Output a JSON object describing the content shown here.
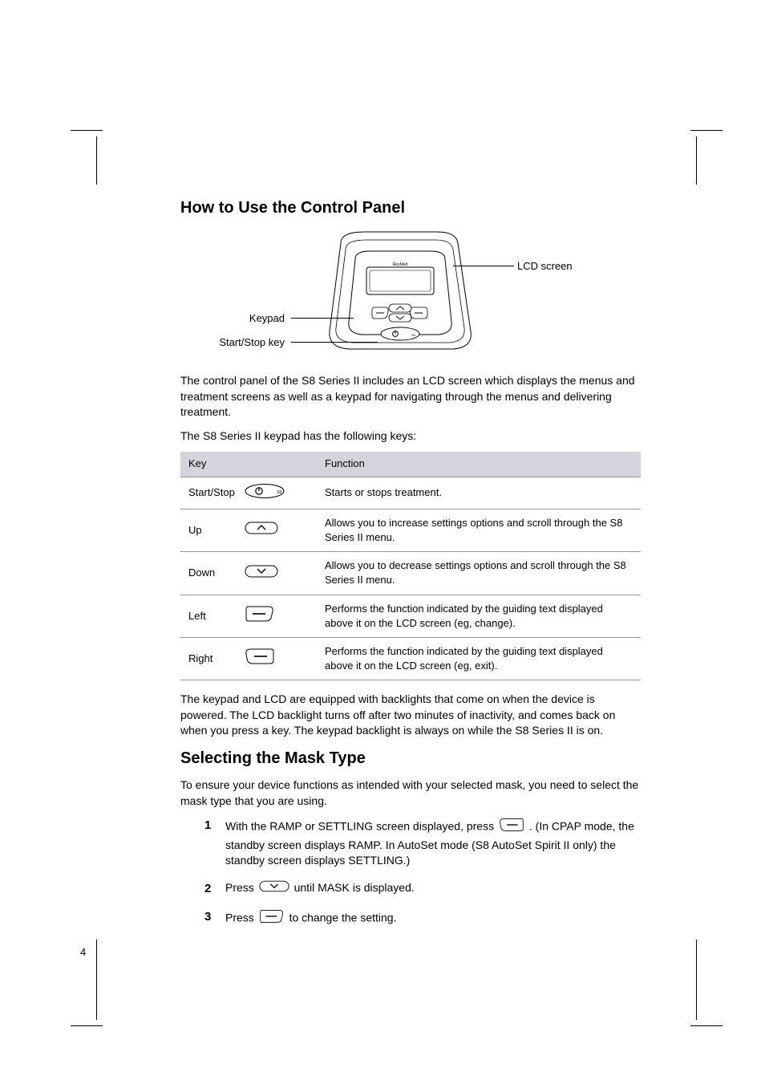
{
  "section1": {
    "title": "How to Use the Control Panel",
    "diagram_labels": {
      "keypad": "Keypad",
      "start_stop_key": "Start/Stop key",
      "lcd_screen": "LCD screen"
    },
    "intro1": "The control panel of the S8 Series II includes an LCD screen which displays the menus and treatment screens as well as a keypad for navigating through the menus and delivering treatment.",
    "intro2": "The S8 Series II keypad has the following keys:",
    "table": {
      "header_key": "Key",
      "header_func": "Function",
      "rows": [
        {
          "name": "Start/Stop",
          "icon": "power",
          "func": "Starts or stops treatment."
        },
        {
          "name": "Up",
          "icon": "up",
          "func": "Allows you to increase settings options and scroll through the S8 Series II menu."
        },
        {
          "name": "Down",
          "icon": "down",
          "func": "Allows you to decrease settings options and scroll through the S8 Series II menu."
        },
        {
          "name": "Left",
          "icon": "left",
          "func": "Performs the function indicated by the guiding text displayed above it on the LCD screen (eg, change)."
        },
        {
          "name": "Right",
          "icon": "right",
          "func": "Performs the function indicated by the guiding text displayed above it on the LCD screen (eg, exit)."
        }
      ]
    },
    "outro": "The keypad and LCD are equipped with backlights that come on when the device is powered. The LCD backlight turns off after two minutes of inactivity, and comes back on when you press a key. The keypad backlight is always on while the S8 Series II is on."
  },
  "section2": {
    "title": "Selecting the Mask Type",
    "intro": "To ensure your device functions as intended with your selected mask, you need to select the mask type that you are using.",
    "steps": [
      {
        "num": "1",
        "pre": "With the RAMP or SETTLING screen displayed, press ",
        "icon": "right",
        "post": " . (In CPAP mode, the standby screen displays RAMP. In AutoSet mode (S8 AutoSet Spirit II only) the standby screen displays SETTLING.)"
      },
      {
        "num": "2",
        "pre": "Press ",
        "icon": "down",
        "post": " until MASK is displayed."
      },
      {
        "num": "3",
        "pre": "Press ",
        "icon": "left",
        "post": " to change the setting."
      }
    ]
  },
  "page_number": "4"
}
